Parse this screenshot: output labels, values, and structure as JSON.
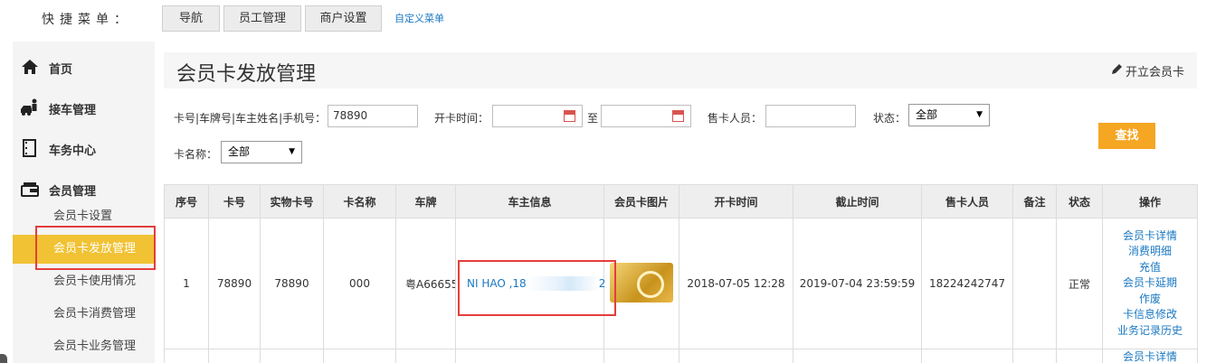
{
  "quick_menu": {
    "label": "快捷菜单：",
    "tabs": [
      "导航",
      "员工管理",
      "商户设置"
    ],
    "custom": "自定义菜单"
  },
  "sidebar": {
    "sections": [
      {
        "label": "首页",
        "icon": "home-icon"
      },
      {
        "label": "接车管理",
        "icon": "car-reception-icon"
      },
      {
        "label": "车务中心",
        "icon": "film-icon"
      },
      {
        "label": "会员管理",
        "icon": "member-card-icon"
      }
    ],
    "sub_items": [
      "会员卡设置",
      "会员卡发放管理",
      "会员卡使用情况",
      "会员卡消费管理",
      "会员卡业务管理"
    ],
    "active_sub": "会员卡发放管理"
  },
  "page": {
    "title": "会员卡发放管理",
    "open_card": "开立会员卡"
  },
  "filters": {
    "search_label": "卡号|车牌号|车主姓名|手机号：",
    "search_value": "78890",
    "date_label": "开卡时间：",
    "date_from": "",
    "date_sep": "至",
    "date_to": "",
    "seller_label": "售卡人员：",
    "seller_value": "",
    "status_label": "状态：",
    "status_value": "全部",
    "card_name_label": "卡名称：",
    "card_name_value": "全部",
    "search_button": "查找"
  },
  "table": {
    "headers": [
      "序号",
      "卡号",
      "实物卡号",
      "卡名称",
      "车牌",
      "车主信息",
      "会员卡图片",
      "开卡时间",
      "截止时间",
      "售卡人员",
      "备注",
      "状态",
      "操作"
    ],
    "rows": [
      {
        "index": "1",
        "card_no": "78890",
        "physical_no": "78890",
        "card_name": "000",
        "plate": "粤A66655",
        "owner": "NI HAO ,18",
        "owner_tail": "2",
        "open_time": "2018-07-05 12:28",
        "end_time": "2019-07-04 23:59:59",
        "seller": "18224242747",
        "remark": "",
        "status": "正常",
        "ops": [
          "会员卡详情",
          "消费明细",
          "充值",
          "会员卡延期",
          "作废",
          "卡信息修改",
          "业务记录历史"
        ]
      }
    ],
    "next_row_partial_op": "会员卡详情"
  }
}
